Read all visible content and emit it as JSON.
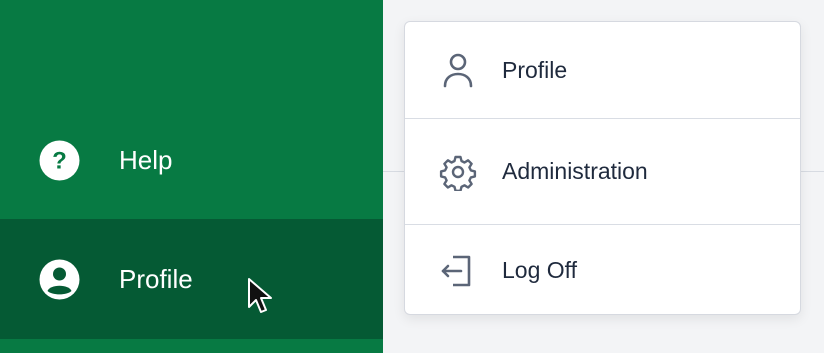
{
  "sidebar": {
    "bg_color": "#077a43",
    "active_color": "#055a34",
    "items": [
      {
        "label": "Help",
        "icon": "help-circle-icon"
      },
      {
        "label": "Profile",
        "icon": "user-circle-icon",
        "active": true
      }
    ]
  },
  "dropdown": {
    "items": [
      {
        "label": "Profile",
        "icon": "user-icon"
      },
      {
        "label": "Administration",
        "icon": "gear-icon"
      },
      {
        "label": "Log Off",
        "icon": "logout-icon"
      }
    ]
  }
}
